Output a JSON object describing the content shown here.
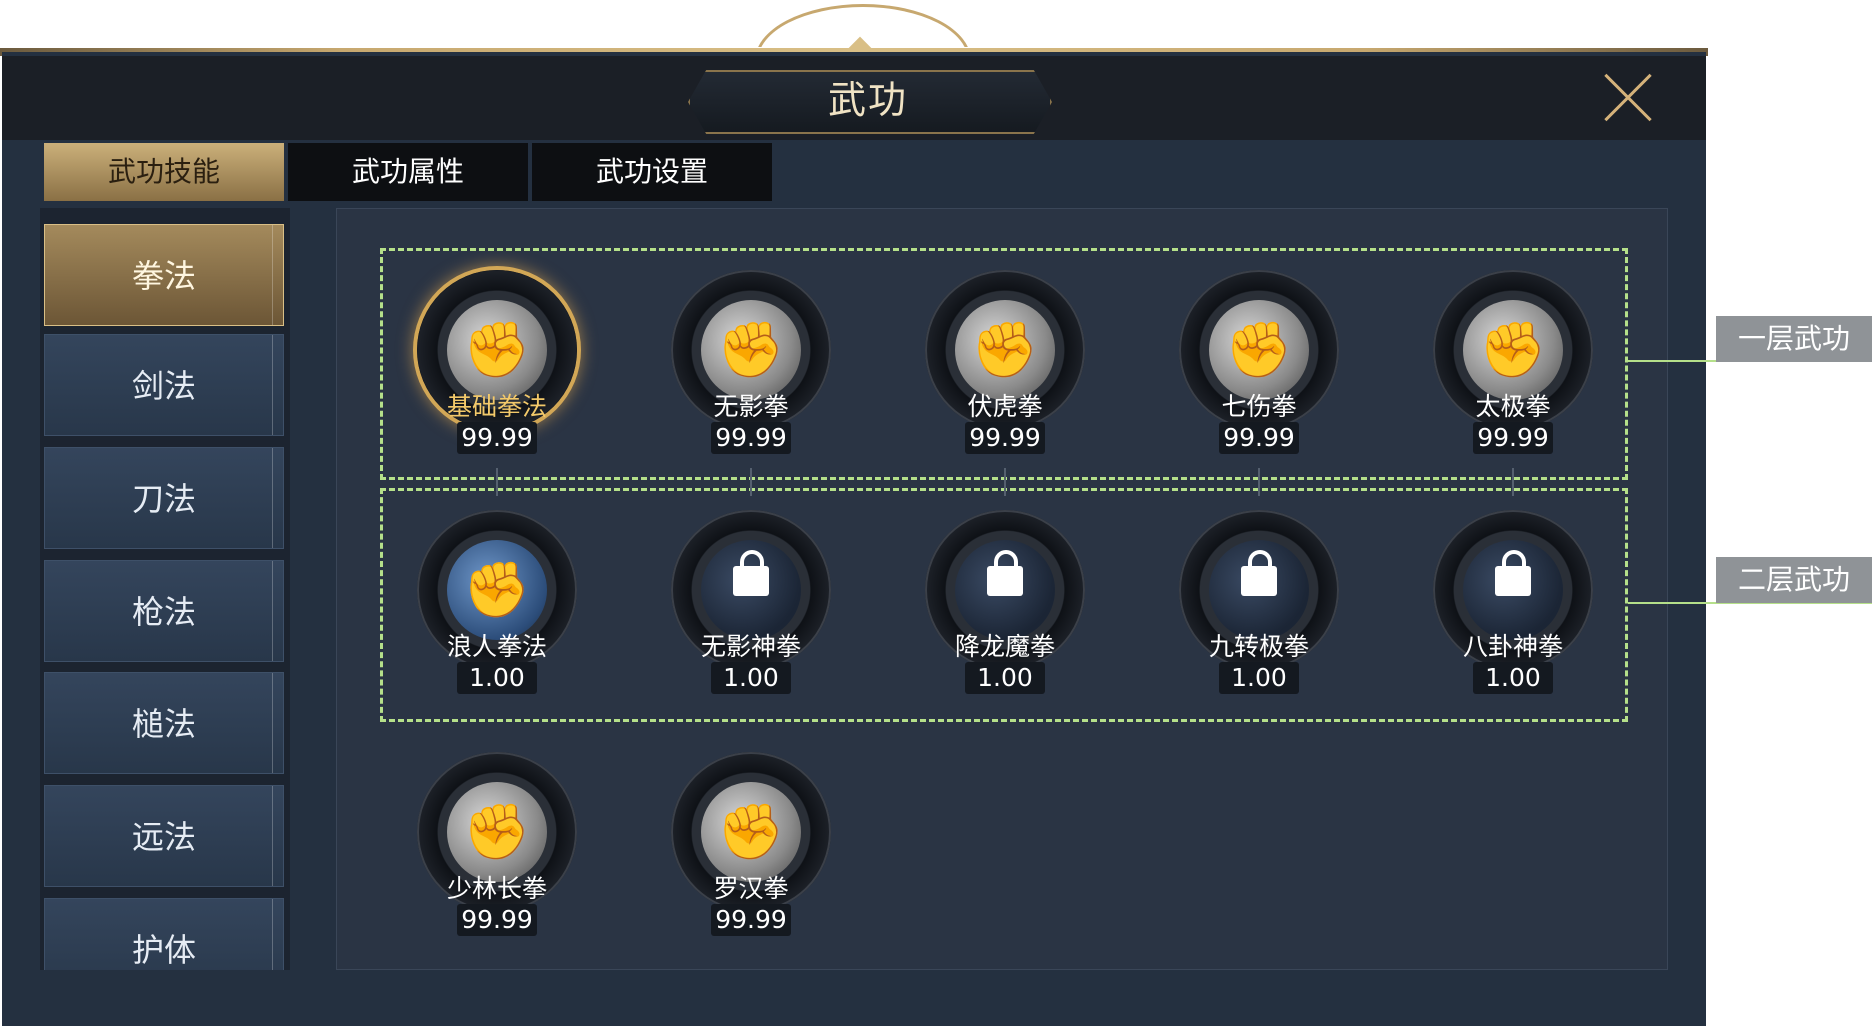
{
  "window": {
    "title": "武功",
    "close_icon": "close-icon"
  },
  "tabs": [
    {
      "label": "武功技能",
      "active": true
    },
    {
      "label": "武功属性",
      "active": false
    },
    {
      "label": "武功设置",
      "active": false
    }
  ],
  "sidebar": {
    "items": [
      {
        "label": "拳法",
        "active": true
      },
      {
        "label": "剑法",
        "active": false
      },
      {
        "label": "刀法",
        "active": false
      },
      {
        "label": "枪法",
        "active": false
      },
      {
        "label": "槌法",
        "active": false
      },
      {
        "label": "远法",
        "active": false
      },
      {
        "label": "护体",
        "active": false
      }
    ]
  },
  "tiers": [
    {
      "label": "一层武功"
    },
    {
      "label": "二层武功"
    }
  ],
  "skills": {
    "row1": [
      {
        "name": "基础拳法",
        "value": "99.99",
        "selected": true,
        "locked": false,
        "icon": "fist-icon"
      },
      {
        "name": "无影拳",
        "value": "99.99",
        "selected": false,
        "locked": false,
        "icon": "fist-icon"
      },
      {
        "name": "伏虎拳",
        "value": "99.99",
        "selected": false,
        "locked": false,
        "icon": "fist-icon"
      },
      {
        "name": "七伤拳",
        "value": "99.99",
        "selected": false,
        "locked": false,
        "icon": "fist-icon"
      },
      {
        "name": "太极拳",
        "value": "99.99",
        "selected": false,
        "locked": false,
        "icon": "fist-icon"
      }
    ],
    "row2": [
      {
        "name": "浪人拳法",
        "value": "1.00",
        "selected": false,
        "locked": false,
        "icon": "fist-icon"
      },
      {
        "name": "无影神拳",
        "value": "1.00",
        "selected": false,
        "locked": true,
        "icon": "lock-icon"
      },
      {
        "name": "降龙魔拳",
        "value": "1.00",
        "selected": false,
        "locked": true,
        "icon": "lock-icon"
      },
      {
        "name": "九转极拳",
        "value": "1.00",
        "selected": false,
        "locked": true,
        "icon": "lock-icon"
      },
      {
        "name": "八卦神拳",
        "value": "1.00",
        "selected": false,
        "locked": true,
        "icon": "lock-icon"
      }
    ],
    "row3": [
      {
        "name": "少林长拳",
        "value": "99.99",
        "selected": false,
        "locked": false,
        "icon": "fist-icon"
      },
      {
        "name": "罗汉拳",
        "value": "99.99",
        "selected": false,
        "locked": false,
        "icon": "fist-icon"
      }
    ]
  },
  "colors": {
    "accent_gold": "#d9bf86",
    "tier_marker": "#b5e08a",
    "panel_bg": "#243040"
  }
}
